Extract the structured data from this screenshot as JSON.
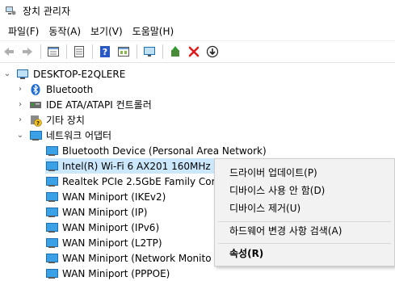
{
  "window": {
    "title": "장치 관리자"
  },
  "menu": [
    {
      "label": "파일(F)"
    },
    {
      "label": "동작(A)"
    },
    {
      "label": "보기(V)"
    },
    {
      "label": "도움말(H)"
    }
  ],
  "toolbar": {
    "icons": [
      "back-icon",
      "forward-icon",
      "properties-icon",
      "list-icon",
      "help-icon",
      "view-icon",
      "monitor-icon",
      "update-driver-icon",
      "uninstall-icon",
      "disable-icon"
    ]
  },
  "tree": {
    "root": "DESKTOP-E2QLERE",
    "items": [
      {
        "label": "Bluetooth"
      },
      {
        "label": "IDE ATA/ATAPI 컨트롤러"
      },
      {
        "label": "기타 장치"
      },
      {
        "label": "네트워크 어댑터"
      }
    ],
    "adapters": [
      {
        "label": "Bluetooth Device (Personal Area Network)"
      },
      {
        "label": "Intel(R) Wi-Fi 6 AX201 160MHz"
      },
      {
        "label": "Realtek PCIe 2.5GbE Family Cor"
      },
      {
        "label": "WAN Miniport (IKEv2)"
      },
      {
        "label": "WAN Miniport (IP)"
      },
      {
        "label": "WAN Miniport (IPv6)"
      },
      {
        "label": "WAN Miniport (L2TP)"
      },
      {
        "label": "WAN Miniport (Network Monito"
      },
      {
        "label": "WAN Miniport (PPPOE)"
      }
    ]
  },
  "context_menu": {
    "items": [
      {
        "label": "드라이버 업데이트(P)"
      },
      {
        "label": "디바이스 사용 안 함(D)"
      },
      {
        "label": "디바이스 제거(U)"
      },
      {
        "label": "하드웨어 변경 사항 검색(A)"
      },
      {
        "label": "속성(R)"
      }
    ]
  }
}
